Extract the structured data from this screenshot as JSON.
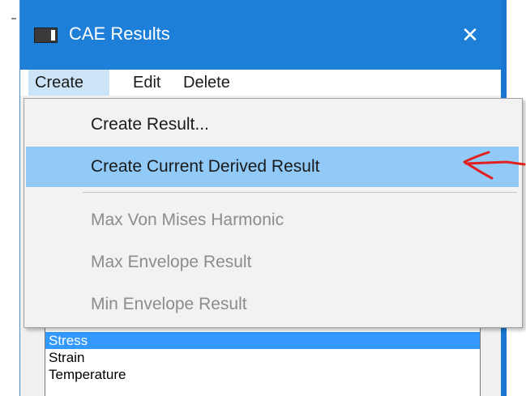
{
  "window": {
    "title": "CAE Results",
    "close_glyph": "✕"
  },
  "menubar": {
    "items": [
      {
        "label": "Create"
      },
      {
        "label": "Edit"
      },
      {
        "label": "Delete"
      }
    ]
  },
  "dropdown": {
    "items": [
      {
        "label": "Create Result...",
        "enabled": true
      },
      {
        "label": "Create Current Derived Result",
        "enabled": true,
        "highlighted": true
      },
      {
        "label": "Max Von Mises Harmonic",
        "enabled": false
      },
      {
        "label": "Max Envelope Result",
        "enabled": false
      },
      {
        "label": "Min Envelope Result",
        "enabled": false
      }
    ]
  },
  "result_list": {
    "items": [
      {
        "label": "Stress",
        "selected": true
      },
      {
        "label": "Strain"
      },
      {
        "label": "Temperature"
      }
    ]
  },
  "colors": {
    "titlebar": "#1e7fd9",
    "menu_active": "#cce4f7",
    "item_hover": "#91c9f7",
    "list_selected": "#3399ff",
    "annotation_arrow": "#e32020"
  },
  "icons": {
    "app": "app-window-icon",
    "close": "close-icon",
    "annotation": "red-arrow-annotation"
  }
}
